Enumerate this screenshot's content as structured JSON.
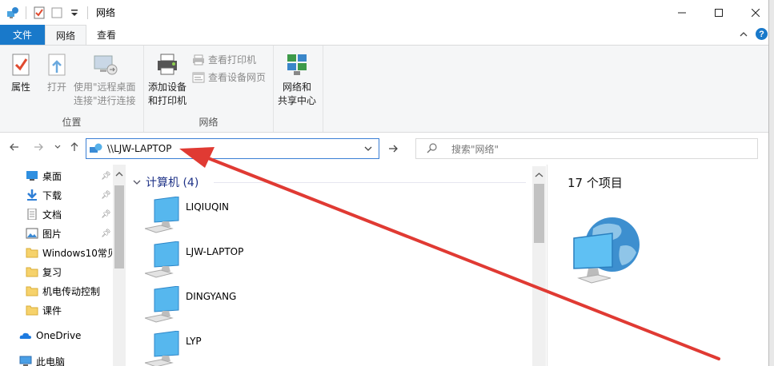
{
  "window": {
    "title": "网络",
    "minimize_icon": "minimize-icon",
    "maximize_icon": "maximize-icon",
    "close_icon": "close-icon"
  },
  "ribbon": {
    "tabs": [
      {
        "label": "文件"
      },
      {
        "label": "网络"
      },
      {
        "label": "查看"
      }
    ],
    "groups": {
      "location": {
        "label": "位置",
        "buttons": [
          {
            "label": "属性",
            "icon": "properties-icon"
          },
          {
            "label": "打开",
            "icon": "open-icon"
          },
          {
            "label_line1": "使用\"远程桌面",
            "label_line2": "连接\"进行连接",
            "icon": "remote-desktop-icon"
          }
        ]
      },
      "network": {
        "label": "网络",
        "add_device": {
          "label_line1": "添加设备",
          "label_line2": "和打印机",
          "icon": "add-printer-icon"
        },
        "view_printers": "查看打印机",
        "view_webpage": "查看设备网页",
        "sharing_center": {
          "label_line1": "网络和",
          "label_line2": "共享中心",
          "icon": "network-sharing-icon"
        }
      }
    }
  },
  "address": {
    "path": "\\\\LJW-LAPTOP",
    "search_placeholder": "搜索\"网络\""
  },
  "nav": {
    "items": [
      {
        "label": "桌面",
        "icon": "desktop-icon",
        "pinned": true
      },
      {
        "label": "下载",
        "icon": "download-icon",
        "pinned": true
      },
      {
        "label": "文档",
        "icon": "documents-icon",
        "pinned": true
      },
      {
        "label": "图片",
        "icon": "pictures-icon",
        "pinned": true
      },
      {
        "label": "Windows10常见",
        "icon": "folder-icon",
        "pinned": false
      },
      {
        "label": "复习",
        "icon": "folder-icon",
        "pinned": false
      },
      {
        "label": "机电传动控制",
        "icon": "folder-icon",
        "pinned": false
      },
      {
        "label": "课件",
        "icon": "folder-icon",
        "pinned": false
      },
      {
        "label": "OneDrive",
        "icon": "onedrive-icon",
        "pinned": false
      },
      {
        "label": "此电脑",
        "icon": "this-pc-icon",
        "pinned": false
      }
    ]
  },
  "content": {
    "section_title": "计算机 (4)",
    "computers": [
      {
        "name": "LIQIUQIN"
      },
      {
        "name": "LJW-LAPTOP"
      },
      {
        "name": "DINGYANG"
      },
      {
        "name": "LYP"
      }
    ]
  },
  "details": {
    "item_count": "17 个项目"
  },
  "colors": {
    "accent": "#1979ca",
    "section_header": "#1e3287",
    "annotation_arrow": "#e03a33"
  }
}
